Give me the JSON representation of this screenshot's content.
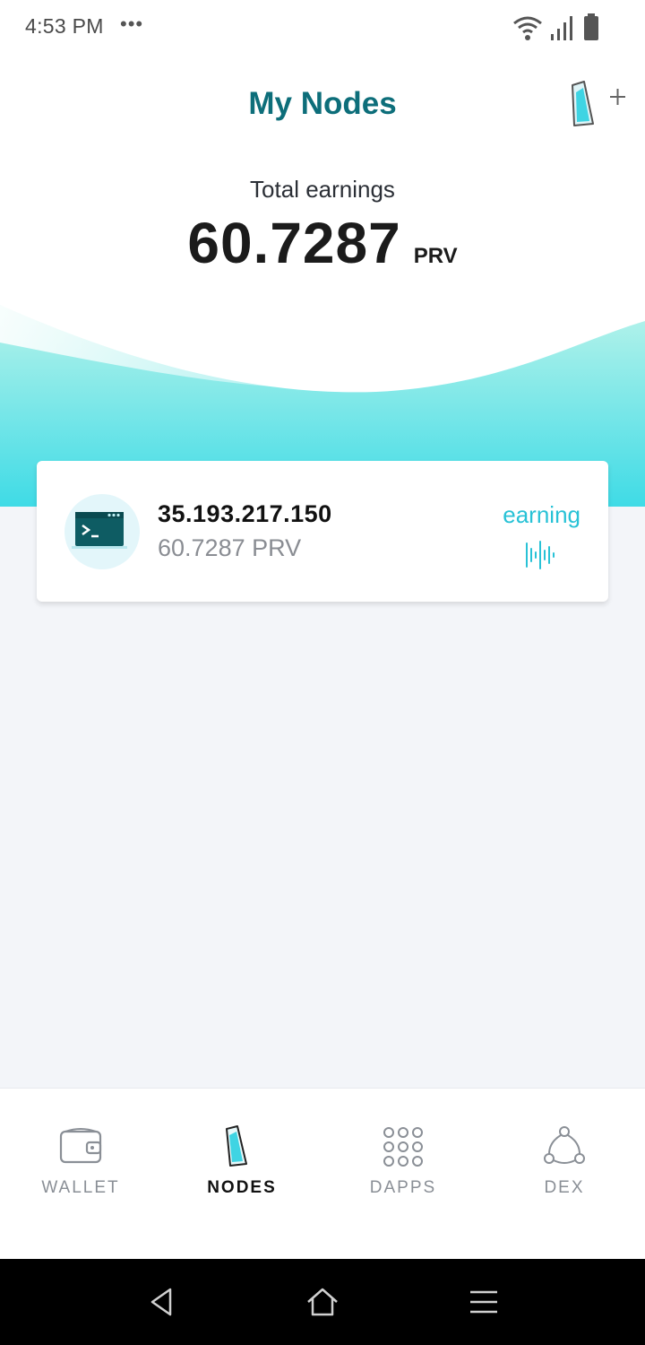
{
  "status_bar": {
    "time": "4:53 PM",
    "dots": "•••",
    "icons": [
      "wifi-icon",
      "signal-icon",
      "battery-icon"
    ]
  },
  "header": {
    "title": "My Nodes",
    "add_node_icon": "add-node-icon",
    "earnings_label": "Total earnings",
    "earnings_value": "60.7287",
    "earnings_unit": "PRV"
  },
  "nodes": [
    {
      "ip": "35.193.217.150",
      "amount": "60.7287 PRV",
      "status": "earning",
      "icon": "terminal-icon",
      "status_icon": "earning-wave-icon"
    }
  ],
  "bottom_nav": {
    "items": [
      {
        "label": "WALLET",
        "icon": "wallet-icon",
        "active": false
      },
      {
        "label": "NODES",
        "icon": "node-icon",
        "active": true
      },
      {
        "label": "DAPPS",
        "icon": "dapps-grid-icon",
        "active": false
      },
      {
        "label": "DEX",
        "icon": "dex-icon",
        "active": false
      }
    ]
  },
  "system_nav": [
    "back-icon",
    "home-icon",
    "menu-icon"
  ],
  "colors": {
    "title": "#0d6e7a",
    "accent": "#28c2d6",
    "wave_top": "#b8f3ea",
    "wave_bottom": "#3fdbe6",
    "background": "#f3f5f9"
  }
}
